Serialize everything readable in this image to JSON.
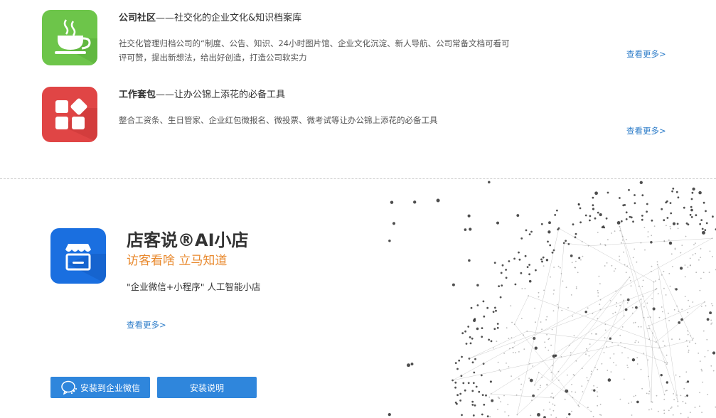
{
  "features": [
    {
      "title_bold": "公司社区",
      "title_rest": "——社交化的企业文化&知识档案库",
      "desc": "社交化管理归档公司的“制度、公告、知识、24小时图片馆、企业文化沉淀、新人导航、公司常备文档可看可评可赞，提出新想法，给出好创造，打造公司软实力",
      "more": "查看更多>",
      "icon": "coffee-cup-icon",
      "color": "#6dc54a"
    },
    {
      "title_bold": "工作套包",
      "title_rest": "——让办公锦上添花的必备工具",
      "desc": "整合工资条、生日管家、企业红包微报名、微投票、微考试等让办公锦上添花的必备工具",
      "more": "查看更多>",
      "icon": "apps-grid-icon",
      "color": "#e04545"
    }
  ],
  "product": {
    "title": "店客说®AI小店",
    "slogan": "访客看啥 立马知道",
    "desc": "\"企业微信+小程序\" 人工智能小店",
    "more": "查看更多>",
    "icon": "storefront-icon",
    "color": "#1a6fe0",
    "slogan_color": "#e8882c"
  },
  "buttons": {
    "install": "安装到企业微信",
    "guide": "安装说明"
  }
}
